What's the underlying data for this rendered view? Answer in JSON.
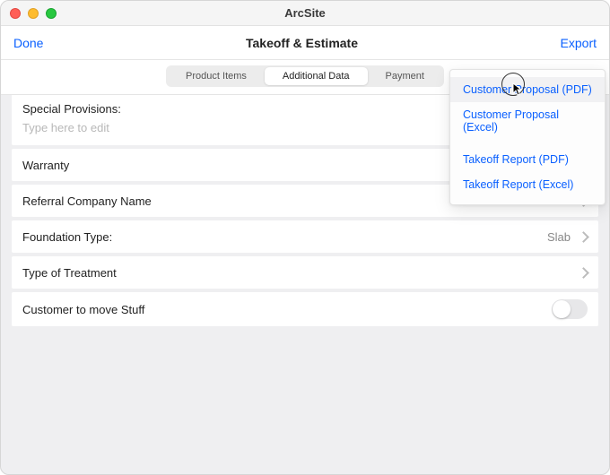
{
  "window": {
    "app_title": "ArcSite"
  },
  "toolbar": {
    "left": "Done",
    "title": "Takeoff & Estimate",
    "right": "Export"
  },
  "tabs": {
    "items": [
      {
        "label": "Product Items",
        "active": false
      },
      {
        "label": "Additional Data",
        "active": true
      },
      {
        "label": "Payment",
        "active": false
      }
    ]
  },
  "form": {
    "special_provisions": {
      "label": "Special Provisions:",
      "placeholder": "Type here to edit"
    },
    "warranty": {
      "label": "Warranty"
    },
    "referral": {
      "label": "Referral Company Name"
    },
    "foundation": {
      "label": "Foundation Type:",
      "value": "Slab"
    },
    "treatment": {
      "label": "Type of Treatment"
    },
    "move_stuff": {
      "label": "Customer to move Stuff",
      "on": false
    }
  },
  "export_menu": {
    "items": [
      "Customer Proposal (PDF)",
      "Customer Proposal (Excel)",
      "Takeoff Report (PDF)",
      "Takeoff Report (Excel)"
    ]
  }
}
